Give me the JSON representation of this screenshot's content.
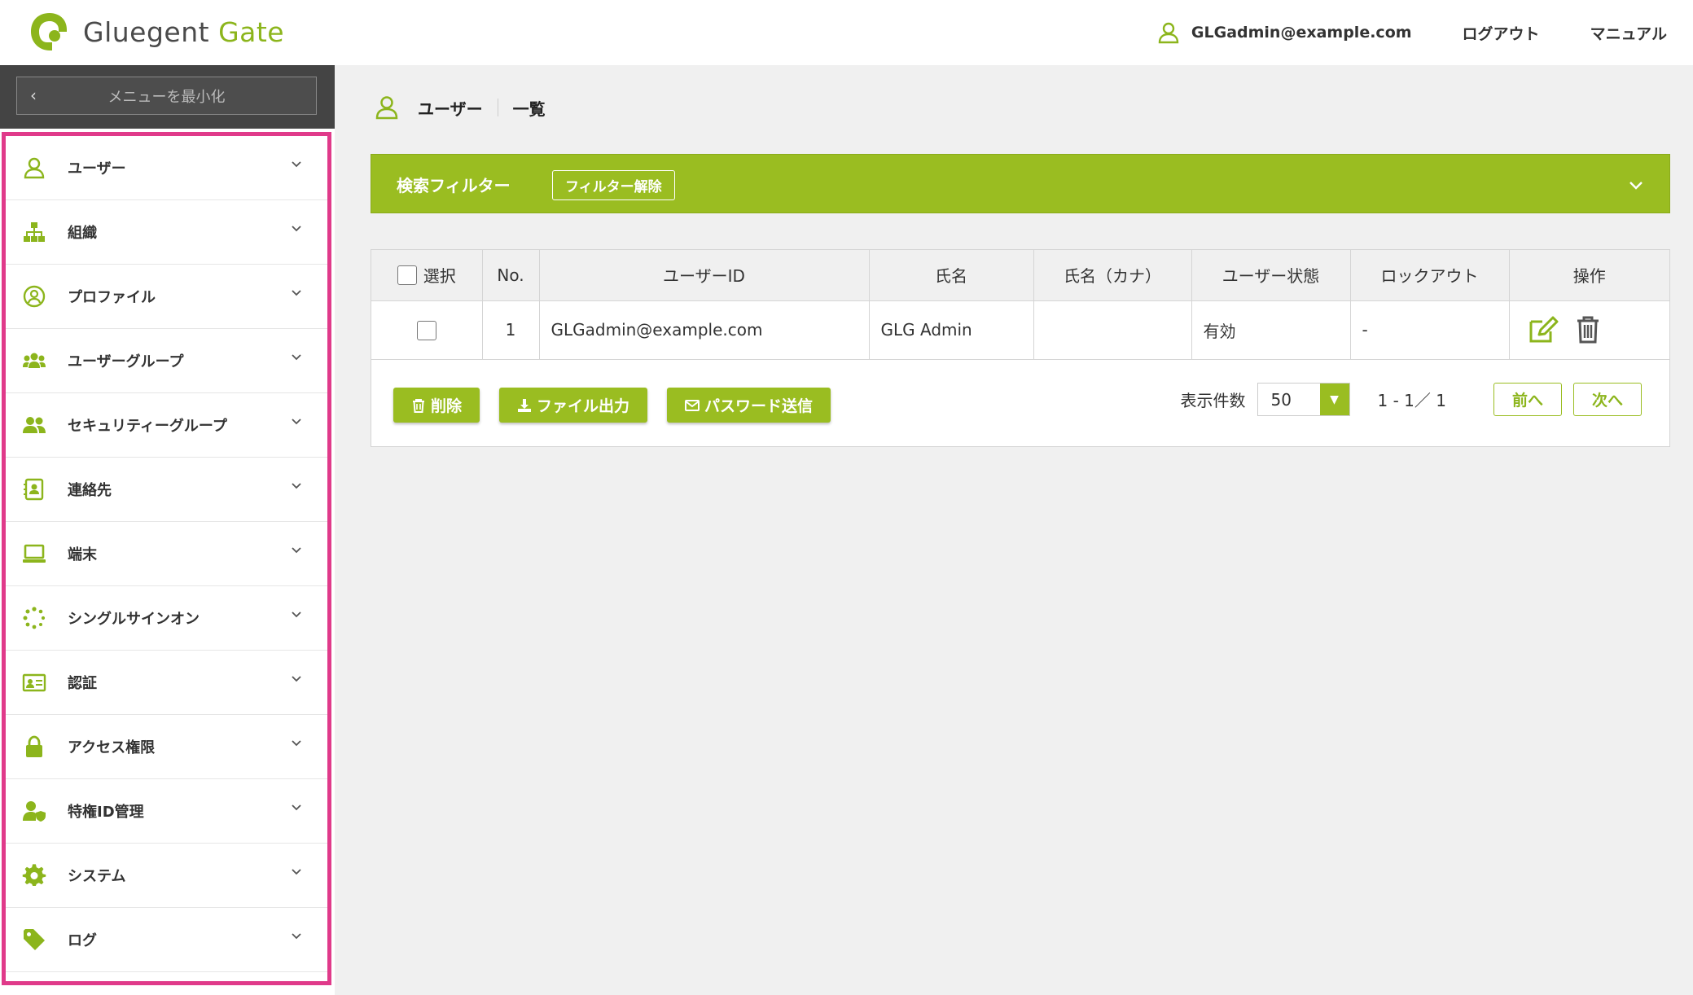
{
  "header": {
    "logo_main": "Gluegent",
    "logo_accent": "Gate",
    "user_email": "GLGadmin@example.com",
    "logout": "ログアウト",
    "manual": "マニュアル"
  },
  "sidebar": {
    "minimize_label": "メニューを最小化",
    "items": [
      {
        "label": "ユーザー",
        "icon": "user-icon"
      },
      {
        "label": "組織",
        "icon": "org-chart-icon"
      },
      {
        "label": "プロファイル",
        "icon": "profile-icon"
      },
      {
        "label": "ユーザーグループ",
        "icon": "users-group-icon"
      },
      {
        "label": "セキュリティーグループ",
        "icon": "security-group-icon"
      },
      {
        "label": "連絡先",
        "icon": "contact-book-icon"
      },
      {
        "label": "端末",
        "icon": "laptop-icon"
      },
      {
        "label": "シングルサインオン",
        "icon": "sso-spinner-icon"
      },
      {
        "label": "認証",
        "icon": "id-card-icon"
      },
      {
        "label": "アクセス権限",
        "icon": "lock-icon"
      },
      {
        "label": "特権ID管理",
        "icon": "user-shield-icon"
      },
      {
        "label": "システム",
        "icon": "gear-icon"
      },
      {
        "label": "ログ",
        "icon": "tag-icon"
      }
    ]
  },
  "breadcrumb": {
    "section": "ユーザー",
    "page": "一覧"
  },
  "filter": {
    "title": "検索フィルター",
    "clear": "フィルター解除"
  },
  "table": {
    "headers": {
      "select": "選択",
      "no": "No.",
      "user_id": "ユーザーID",
      "name": "氏名",
      "kana": "氏名（カナ）",
      "status": "ユーザー状態",
      "lockout": "ロックアウト",
      "ops": "操作"
    },
    "rows": [
      {
        "no": "1",
        "user_id": "GLGadmin@example.com",
        "name": "GLG Admin",
        "kana": "",
        "status": "有効",
        "lockout": "-"
      }
    ]
  },
  "actions": {
    "delete": "削除",
    "export": "ファイル出力",
    "send_password": "パスワード送信"
  },
  "pager": {
    "label": "表示件数",
    "page_size": "50",
    "info": "1 - 1／ 1",
    "prev": "前へ",
    "next": "次へ"
  },
  "colors": {
    "accent": "#9abd21",
    "highlight": "#e03a8a",
    "sidebar_dark": "#444444"
  }
}
